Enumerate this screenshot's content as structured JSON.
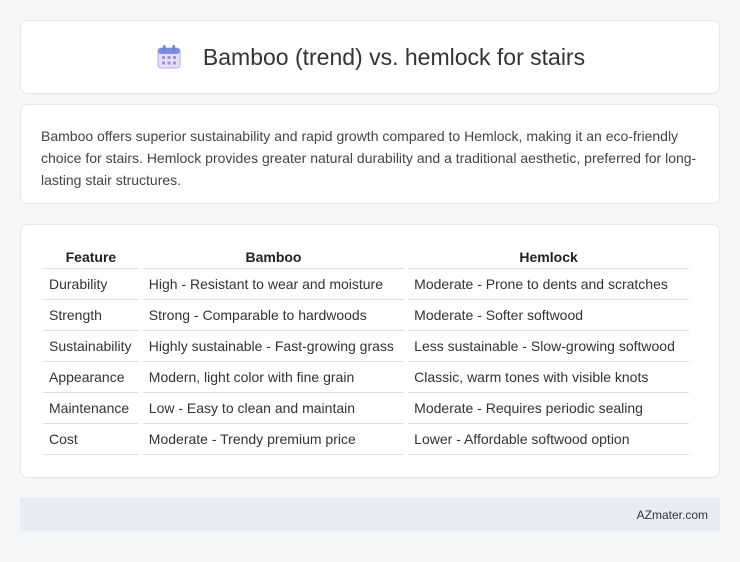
{
  "header": {
    "title": "Bamboo (trend) vs. hemlock for stairs",
    "icon": "calendar-icon"
  },
  "summary": {
    "text": "Bamboo offers superior sustainability and rapid growth compared to Hemlock, making it an eco-friendly choice for stairs. Hemlock provides greater natural durability and a traditional aesthetic, preferred for long-lasting stair structures."
  },
  "table": {
    "headers": [
      "Feature",
      "Bamboo",
      "Hemlock"
    ],
    "rows": [
      [
        "Durability",
        "High - Resistant to wear and moisture",
        "Moderate - Prone to dents and scratches"
      ],
      [
        "Strength",
        "Strong - Comparable to hardwoods",
        "Moderate - Softer softwood"
      ],
      [
        "Sustainability",
        "Highly sustainable - Fast-growing grass",
        "Less sustainable - Slow-growing softwood"
      ],
      [
        "Appearance",
        "Modern, light color with fine grain",
        "Classic, warm tones with visible knots"
      ],
      [
        "Maintenance",
        "Low - Easy to clean and maintain",
        "Moderate - Requires periodic sealing"
      ],
      [
        "Cost",
        "Moderate - Trendy premium price",
        "Lower - Affordable softwood option"
      ]
    ]
  },
  "footer": {
    "text": "AZmater.com"
  }
}
